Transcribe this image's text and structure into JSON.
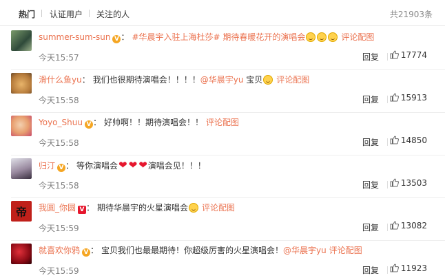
{
  "tabs": [
    {
      "label": "热门",
      "active": true
    },
    {
      "label": "认证用户",
      "active": false
    },
    {
      "label": "关注的人",
      "active": false
    }
  ],
  "total": "共21903条",
  "comments": [
    {
      "user": "summer-sum-sun",
      "badge": "V",
      "colon": "：",
      "text": "#华晨宇入驻上海杜莎# 期待春暖花开的演唱会",
      "pic": "评论配图",
      "time": "今天15:57",
      "reply": "回复",
      "likes": "17774"
    },
    {
      "user": "滑什么鱼yu",
      "badge": "",
      "colon": "：",
      "text": "我们也很期待演唱会！！！！",
      "mention": "@华晨宇yu",
      "text2": " 宝贝",
      "pic": "评论配图",
      "time": "今天15:58",
      "reply": "回复",
      "likes": "15913"
    },
    {
      "user": "Yoyo_Shuu",
      "badge": "V",
      "colon": "：",
      "text": "好帅啊！！期待演唱会！！",
      "pic": "评论配图",
      "time": "今天15:58",
      "reply": "回复",
      "likes": "14850"
    },
    {
      "user": "归汀",
      "badge": "V",
      "colon": "：",
      "text": "等你演唱会",
      "text2": "演唱会见！！！",
      "time": "今天15:58",
      "reply": "回复",
      "likes": "13503"
    },
    {
      "user": "我圆_你圆",
      "badge": "V",
      "colon": "：",
      "text": "期待华晨宇的火星演唱会",
      "pic": "评论配图",
      "time": "今天15:59",
      "reply": "回复",
      "likes": "13082"
    },
    {
      "user": "就喜欢你鸦",
      "badge": "V",
      "colon": "：",
      "text": "宝贝我们也最最期待！你超级厉害的火星演唱会！",
      "mention": "@华晨宇yu",
      "pic": "评论配图",
      "time": "今天15:59",
      "reply": "回复",
      "likes": "11923"
    }
  ],
  "colors": {
    "accent": "#eb7350",
    "vbadge": "#f5a623",
    "heart": "#e6162d"
  }
}
